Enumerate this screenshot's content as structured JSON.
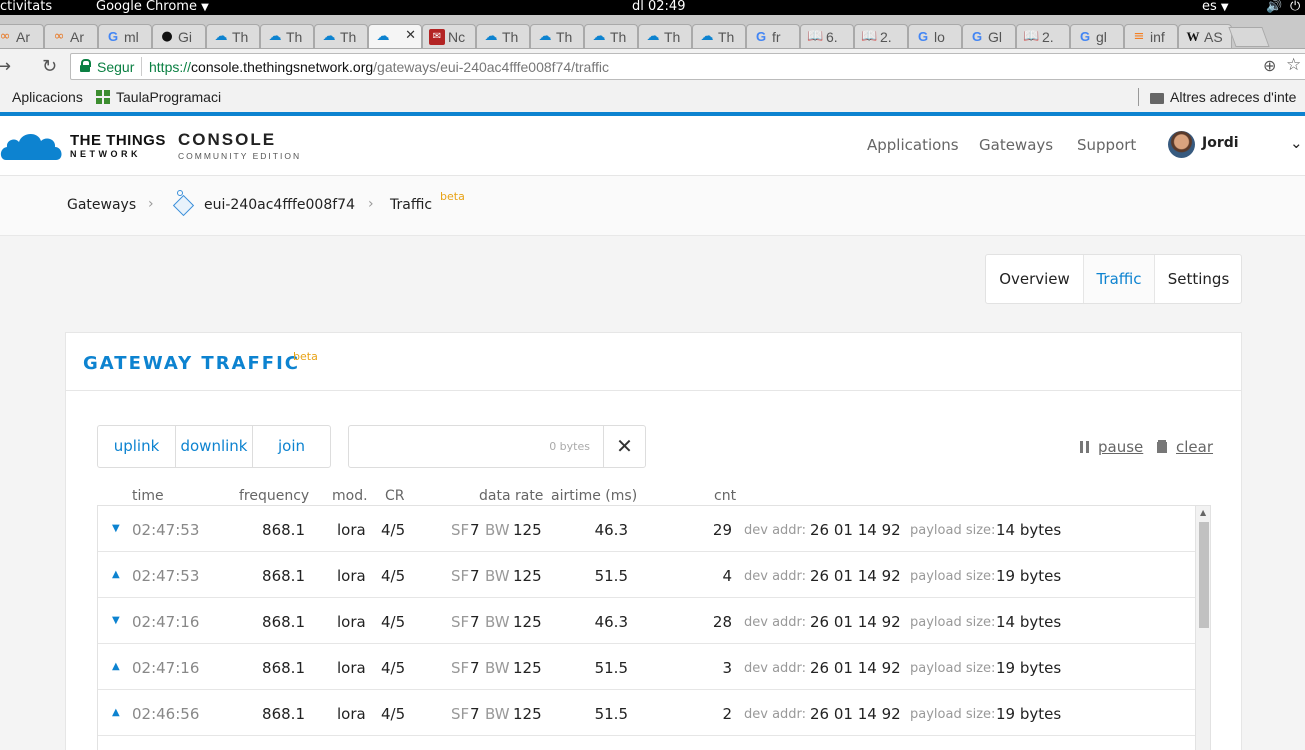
{
  "gnome": {
    "activities": "ctivitats",
    "app_name": "Google Chrome",
    "clock": "dl 02:49",
    "lang": "es"
  },
  "tabs": [
    {
      "icon": "ard",
      "label": "Ar"
    },
    {
      "icon": "ard",
      "label": "Ar"
    },
    {
      "icon": "goog",
      "label": "ml"
    },
    {
      "icon": "gh",
      "label": "Gi"
    },
    {
      "icon": "cloud",
      "label": "Th"
    },
    {
      "icon": "cloud",
      "label": "Th"
    },
    {
      "icon": "cloud",
      "label": "Th"
    },
    {
      "icon": "cloud",
      "label": "",
      "active": true
    },
    {
      "icon": "red",
      "label": "Nc"
    },
    {
      "icon": "cloud",
      "label": "Th"
    },
    {
      "icon": "cloud",
      "label": "Th"
    },
    {
      "icon": "cloud",
      "label": "Th"
    },
    {
      "icon": "cloud",
      "label": "Th"
    },
    {
      "icon": "cloud",
      "label": "Th"
    },
    {
      "icon": "goog",
      "label": "fr"
    },
    {
      "icon": "book",
      "label": "6."
    },
    {
      "icon": "book",
      "label": "2."
    },
    {
      "icon": "goog",
      "label": "lo"
    },
    {
      "icon": "goog",
      "label": "Gl"
    },
    {
      "icon": "book",
      "label": "2."
    },
    {
      "icon": "goog",
      "label": "gl"
    },
    {
      "icon": "so",
      "label": "inf"
    },
    {
      "icon": "wiki",
      "label": "AS"
    }
  ],
  "omnibox": {
    "secure_label": "Segur",
    "url_proto": "https://",
    "url_host": "console.thethingsnetwork.org",
    "url_path": "/gateways/eui-240ac4fffe008f74/traffic"
  },
  "bookmarks": {
    "apps": "Aplicacions",
    "item1": "TaulaProgramaci",
    "other": "Altres adreces d'inte"
  },
  "header": {
    "brand_top": "THE THINGS",
    "brand_bottom": "NETWORK",
    "console": "CONSOLE",
    "console_sub": "COMMUNITY EDITION",
    "nav": [
      "Applications",
      "Gateways",
      "Support"
    ],
    "user": "Jordi"
  },
  "breadcrumb": {
    "gateways": "Gateways",
    "gateway_id": "eui-240ac4fffe008f74",
    "traffic": "Traffic",
    "beta": "beta"
  },
  "subtabs": [
    "Overview",
    "Traffic",
    "Settings"
  ],
  "panel": {
    "title": "GATEWAY TRAFFIC",
    "beta": "beta",
    "filters": [
      "uplink",
      "downlink",
      "join"
    ],
    "search_placeholder": "0 bytes",
    "clear_x": "✕",
    "pause": "pause",
    "clear": "clear"
  },
  "columns": [
    "time",
    "frequency",
    "mod.",
    "CR",
    "data rate",
    "airtime (ms)",
    "cnt"
  ],
  "row_labels": {
    "sf": "SF",
    "bw": "BW",
    "dev_addr": "dev addr:",
    "payload": "payload size:"
  },
  "rows": [
    {
      "dir": "down",
      "time": "02:47:53",
      "freq": "868.1",
      "mod": "lora",
      "cr": "4/5",
      "sf": "7",
      "bw": "125",
      "airtime": "46.3",
      "cnt": "29",
      "dev_addr": "26 01 14 92",
      "payload": "14 bytes"
    },
    {
      "dir": "up",
      "time": "02:47:53",
      "freq": "868.1",
      "mod": "lora",
      "cr": "4/5",
      "sf": "7",
      "bw": "125",
      "airtime": "51.5",
      "cnt": "4",
      "dev_addr": "26 01 14 92",
      "payload": "19 bytes"
    },
    {
      "dir": "down",
      "time": "02:47:16",
      "freq": "868.1",
      "mod": "lora",
      "cr": "4/5",
      "sf": "7",
      "bw": "125",
      "airtime": "46.3",
      "cnt": "28",
      "dev_addr": "26 01 14 92",
      "payload": "14 bytes"
    },
    {
      "dir": "up",
      "time": "02:47:16",
      "freq": "868.1",
      "mod": "lora",
      "cr": "4/5",
      "sf": "7",
      "bw": "125",
      "airtime": "51.5",
      "cnt": "3",
      "dev_addr": "26 01 14 92",
      "payload": "19 bytes"
    },
    {
      "dir": "up",
      "time": "02:46:56",
      "freq": "868.1",
      "mod": "lora",
      "cr": "4/5",
      "sf": "7",
      "bw": "125",
      "airtime": "51.5",
      "cnt": "2",
      "dev_addr": "26 01 14 92",
      "payload": "19 bytes"
    }
  ],
  "colors": {
    "accent": "#0d83d0",
    "beta": "#e8a317",
    "secure": "#0b8043"
  }
}
